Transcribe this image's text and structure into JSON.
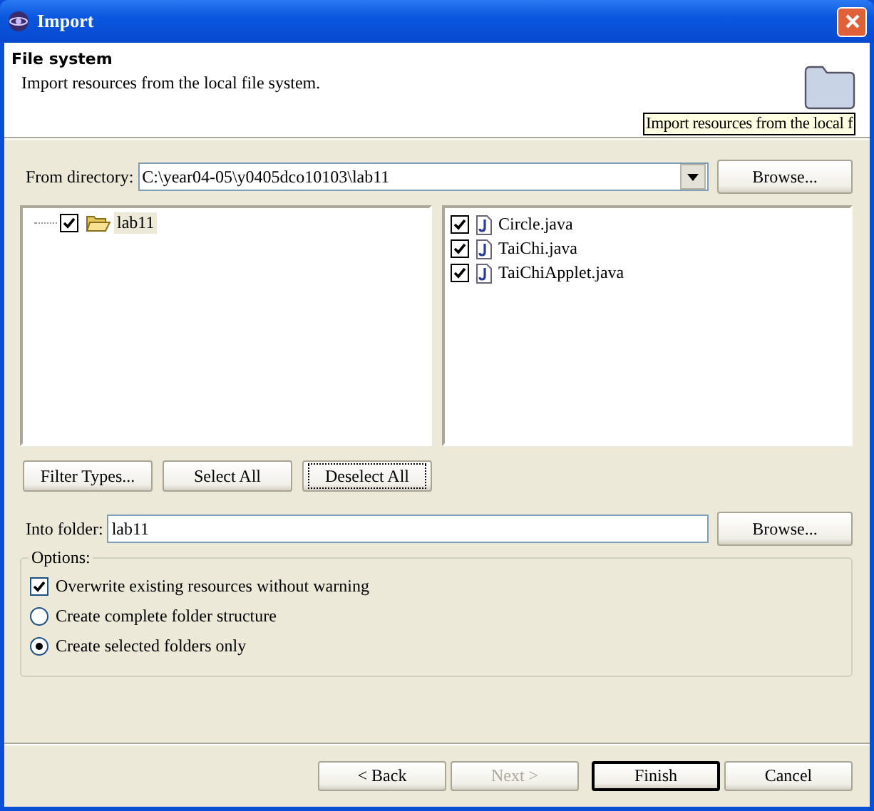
{
  "window": {
    "title": "Import"
  },
  "header": {
    "title": "File system",
    "description": "Import resources from the local file system.",
    "tooltip": "Import resources from the local f"
  },
  "from_directory": {
    "label": "From directory:",
    "value": "C:\\year04-05\\y0405dco10103\\lab11",
    "browse": "Browse..."
  },
  "folder_tree": [
    {
      "label": "lab11",
      "checked": true,
      "selected": true
    }
  ],
  "files": [
    {
      "name": "Circle.java",
      "checked": true
    },
    {
      "name": "TaiChi.java",
      "checked": true
    },
    {
      "name": "TaiChiApplet.java",
      "checked": true
    }
  ],
  "selection_buttons": [
    {
      "label": "Filter Types...",
      "focused": false
    },
    {
      "label": "Select All",
      "focused": false
    },
    {
      "label": "Deselect All",
      "focused": true
    }
  ],
  "into_folder": {
    "label": "Into folder:",
    "value": "lab11",
    "browse": "Browse..."
  },
  "options": {
    "title": "Options:",
    "items": [
      {
        "kind": "checkbox",
        "label": "Overwrite existing resources without warning",
        "checked": true
      },
      {
        "kind": "radio",
        "label": "Create complete folder structure",
        "selected": false
      },
      {
        "kind": "radio",
        "label": "Create selected folders only",
        "selected": true
      }
    ]
  },
  "buttons": [
    {
      "label": "< Back",
      "disabled": false,
      "default": false
    },
    {
      "label": "Next >",
      "disabled": true,
      "default": false
    },
    {
      "label": "Finish",
      "disabled": false,
      "default": true
    },
    {
      "label": "Cancel",
      "disabled": false,
      "default": false
    }
  ]
}
